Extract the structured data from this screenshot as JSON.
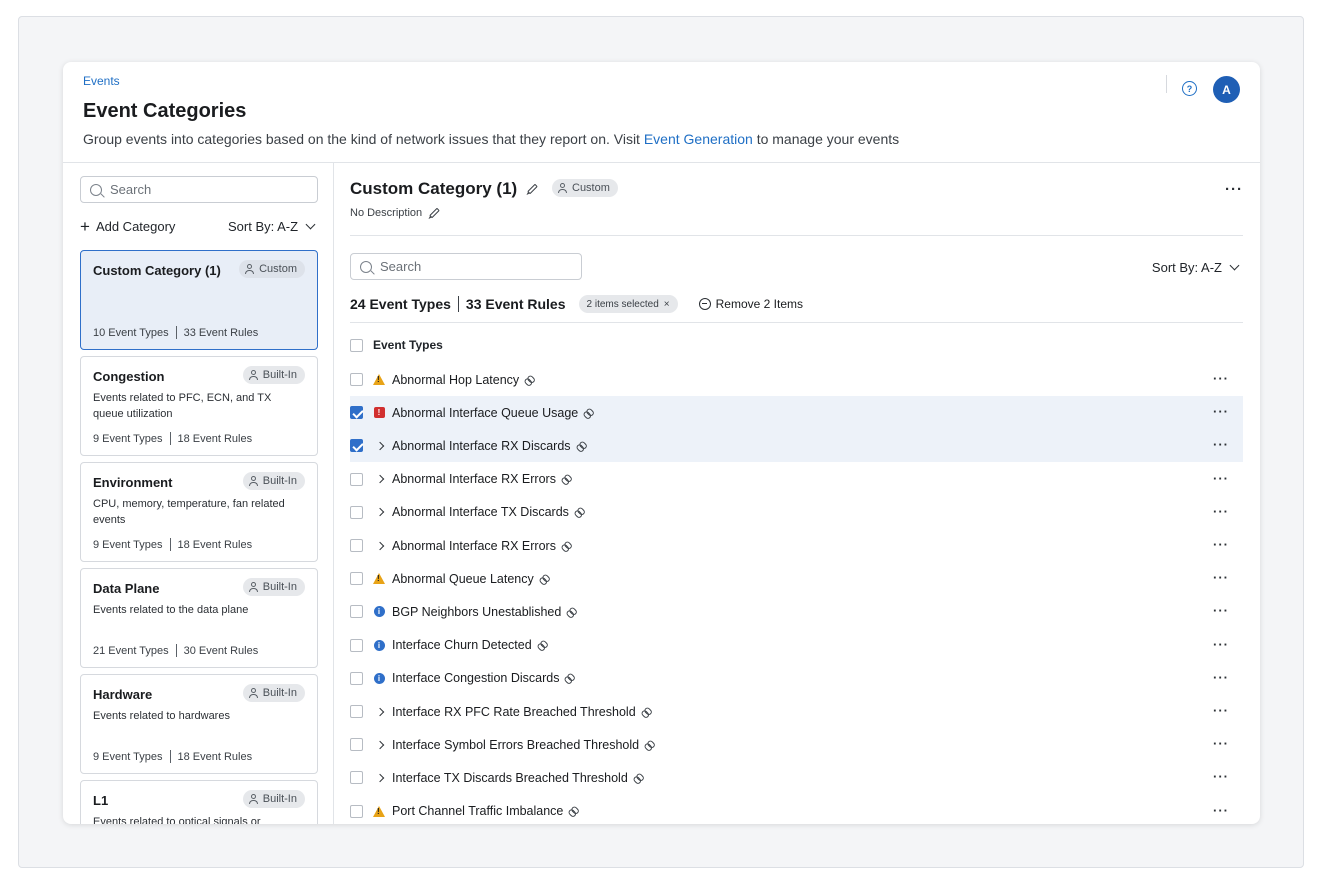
{
  "header": {
    "breadcrumb": "Events",
    "title": "Event Categories",
    "description_prefix": "Group events into categories based on the kind of network issues that they report on. Visit ",
    "description_link": "Event Generation",
    "description_suffix": " to manage your events",
    "help_icon": "?",
    "avatar_initial": "A"
  },
  "sidebar": {
    "search_placeholder": "Search",
    "add_category": "Add Category",
    "sort_label": "Sort By: A-Z",
    "categories": [
      {
        "name": "Custom Category (1)",
        "badge": "Custom",
        "description": "",
        "event_types": "10 Event Types",
        "event_rules": "33 Event Rules",
        "active": true
      },
      {
        "name": "Congestion",
        "badge": "Built-In",
        "description": "Events related to PFC, ECN, and TX queue utilization",
        "event_types": "9 Event Types",
        "event_rules": "18 Event Rules"
      },
      {
        "name": "Environment",
        "badge": "Built-In",
        "description": "CPU, memory, temperature, fan related events",
        "event_types": "9 Event Types",
        "event_rules": "18 Event Rules"
      },
      {
        "name": "Data Plane",
        "badge": "Built-In",
        "description": "Events related to the data plane",
        "event_types": "21 Event Types",
        "event_rules": "30 Event Rules"
      },
      {
        "name": "Hardware",
        "badge": "Built-In",
        "description": "Events related to hardwares",
        "event_types": "9 Event Types",
        "event_rules": "18 Event Rules"
      },
      {
        "name": "L1",
        "badge": "Built-In",
        "description": "Events related to optical signals or physical",
        "event_types": "",
        "event_rules": ""
      }
    ]
  },
  "main": {
    "title": "Custom Category (1)",
    "badge": "Custom",
    "description": "No Description",
    "search_placeholder": "Search",
    "sort_label": "Sort By: A-Z",
    "event_types_count": "24 Event Types",
    "event_rules_count": "33 Event Rules",
    "selected_chip": "2 items selected",
    "remove_label": "Remove 2 Items",
    "list_header": "Event Types",
    "rows": [
      {
        "label": "Abnormal Hop Latency",
        "icon": "warning-icon",
        "checked": false
      },
      {
        "label": "Abnormal Interface Queue Usage",
        "icon": "critical-icon",
        "checked": true
      },
      {
        "label": "Abnormal Interface RX Discards",
        "icon": "chevron-right-icon",
        "checked": true
      },
      {
        "label": "Abnormal Interface RX Errors",
        "icon": "chevron-right-icon",
        "checked": false
      },
      {
        "label": "Abnormal Interface TX Discards",
        "icon": "chevron-right-icon",
        "checked": false
      },
      {
        "label": "Abnormal Interface RX Errors",
        "icon": "chevron-right-icon",
        "checked": false
      },
      {
        "label": "Abnormal Queue Latency",
        "icon": "warning-icon",
        "checked": false
      },
      {
        "label": "BGP Neighbors Unestablished",
        "icon": "info-icon",
        "checked": false
      },
      {
        "label": "Interface Churn Detected",
        "icon": "info-icon",
        "checked": false
      },
      {
        "label": "Interface Congestion Discards",
        "icon": "info-icon",
        "checked": false
      },
      {
        "label": "Interface RX PFC Rate Breached Threshold",
        "icon": "chevron-right-icon",
        "checked": false
      },
      {
        "label": "Interface Symbol Errors Breached Threshold",
        "icon": "chevron-right-icon",
        "checked": false
      },
      {
        "label": "Interface TX Discards Breached Threshold",
        "icon": "chevron-right-icon",
        "checked": false
      },
      {
        "label": "Port Channel Traffic Imbalance",
        "icon": "warning-icon",
        "checked": false
      }
    ]
  },
  "colors": {
    "accent": "#2f6fc9",
    "link": "#1f6fc5",
    "warning": "#e8a317",
    "critical": "#d12f2f",
    "selected_row": "#edf2f9"
  }
}
